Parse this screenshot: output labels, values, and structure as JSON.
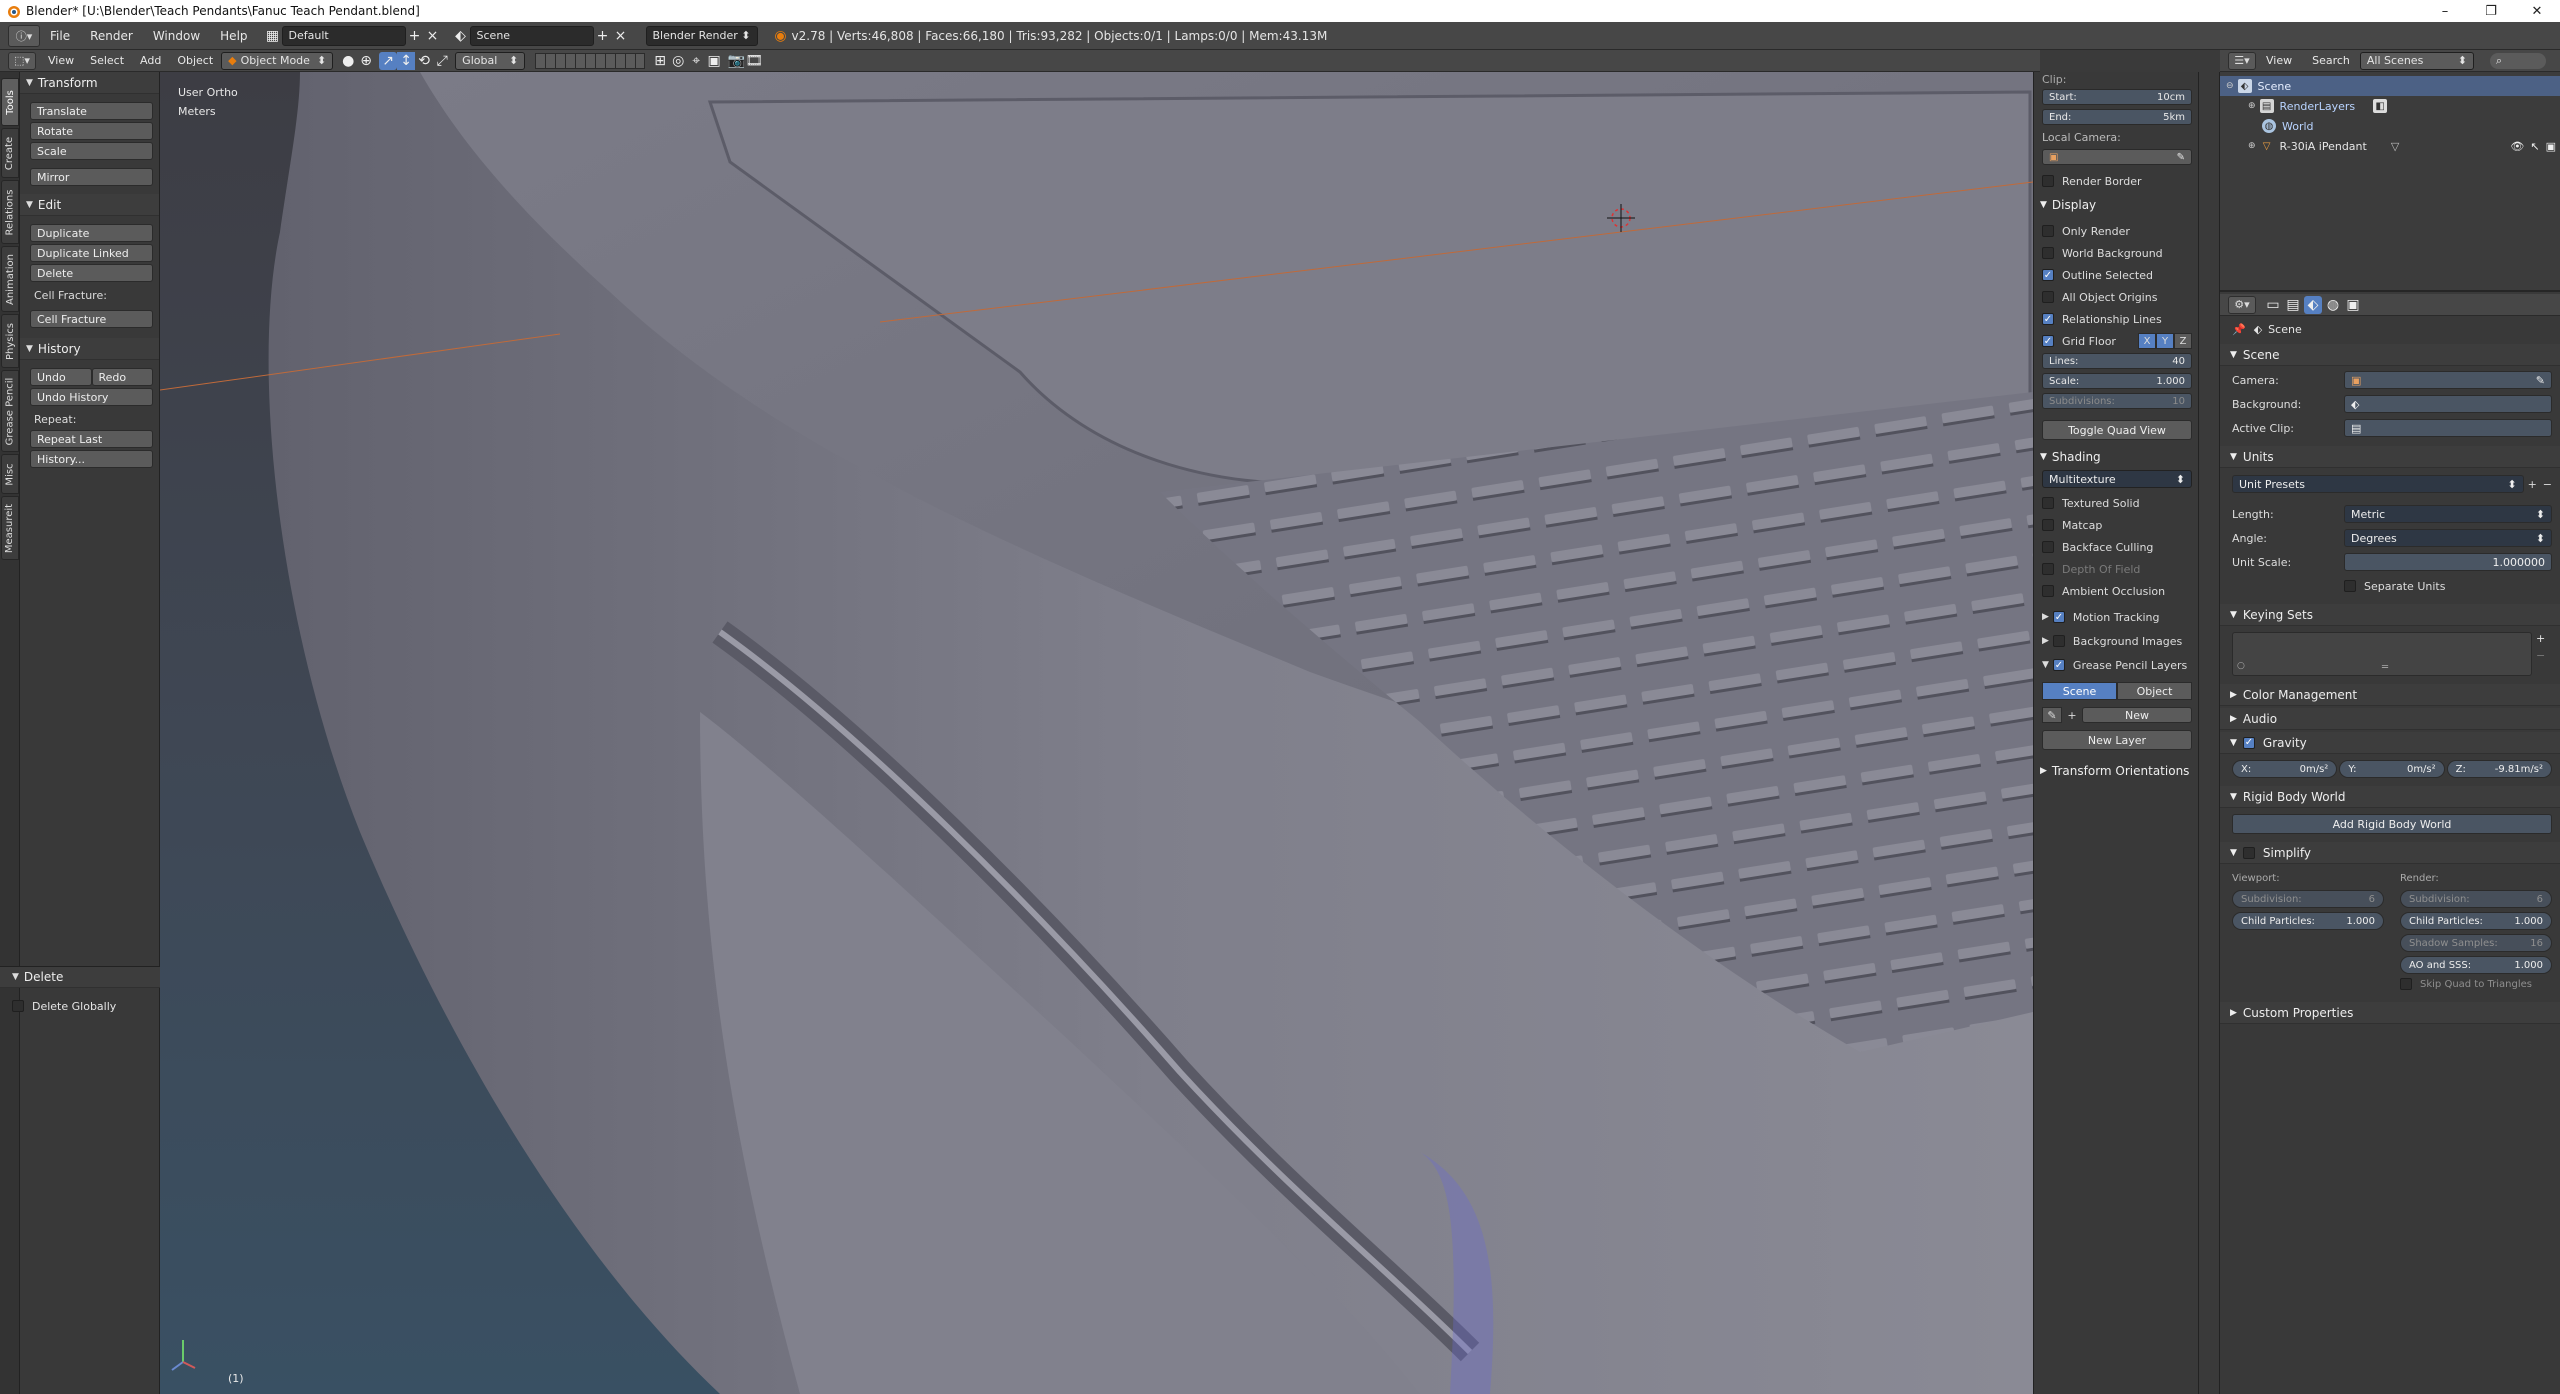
{
  "window": {
    "title": "Blender* [U:\\Blender\\Teach Pendants\\Fanuc Teach Pendant.blend]",
    "minimize_glyph": "–",
    "maximize_glyph": "❐",
    "close_glyph": "✕"
  },
  "info_header": {
    "editor_icon": "info-icon",
    "menus": [
      "File",
      "Render",
      "Window",
      "Help"
    ],
    "layout": "Default",
    "scene": "Scene",
    "engine": "Blender Render",
    "stats": "v2.78 | Verts:46,808 | Faces:66,180 | Tris:93,282 | Objects:0/1 | Lamps:0/0 | Mem:43.13M"
  },
  "view3d_header": {
    "menus": [
      "View",
      "Select",
      "Add",
      "Object"
    ],
    "mode": "Object Mode",
    "orientation": "Global"
  },
  "tabs": [
    "Tools",
    "Create",
    "Relations",
    "Animation",
    "Physics",
    "Grease Pencil",
    "Misc",
    "Measureit"
  ],
  "toolshelf": {
    "transform": {
      "title": "Transform",
      "buttons": [
        "Translate",
        "Rotate",
        "Scale",
        "Mirror"
      ]
    },
    "edit": {
      "title": "Edit",
      "buttons": [
        "Duplicate",
        "Duplicate Linked",
        "Delete"
      ],
      "label": "Cell Fracture:",
      "extra": "Cell Fracture"
    },
    "history": {
      "title": "History",
      "undo": "Undo",
      "redo": "Redo",
      "undo_history": "Undo History",
      "repeat_label": "Repeat:",
      "repeat_last": "Repeat Last",
      "history": "History..."
    },
    "operator": {
      "title": "Delete",
      "option": "Delete Globally"
    }
  },
  "viewport": {
    "view_name": "User Ortho",
    "units": "Meters",
    "frame": "(1)"
  },
  "npanel": {
    "clip_title": "Clip:",
    "clip_start_label": "Start:",
    "clip_start": "10cm",
    "clip_end_label": "End:",
    "clip_end": "5km",
    "local_camera": "Local Camera:",
    "render_border": "Render Border",
    "display": {
      "title": "Display",
      "items": [
        {
          "label": "Only Render",
          "checked": false
        },
        {
          "label": "World Background",
          "checked": false
        },
        {
          "label": "Outline Selected",
          "checked": true
        },
        {
          "label": "All Object Origins",
          "checked": false
        },
        {
          "label": "Relationship Lines",
          "checked": true
        }
      ],
      "grid_floor": "Grid Floor",
      "axes": [
        "X",
        "Y",
        "Z"
      ],
      "lines_label": "Lines:",
      "lines": "40",
      "scale_label": "Scale:",
      "scale": "1.000",
      "subdiv_label": "Subdivisions:",
      "subdiv": "10",
      "toggle_quad": "Toggle Quad View"
    },
    "shading": {
      "title": "Shading",
      "mode": "Multitexture",
      "items": [
        "Textured Solid",
        "Matcap",
        "Backface Culling",
        "Depth Of Field",
        "Ambient Occlusion"
      ]
    },
    "motion_tracking": "Motion Tracking",
    "background_images": "Background Images",
    "gp_layers": "Grease Pencil Layers",
    "gp_tabs": [
      "Scene",
      "Object"
    ],
    "gp_new": "New",
    "gp_new_layer": "New Layer",
    "transform_orient": "Transform Orientations"
  },
  "outliner": {
    "view": "View",
    "search": "Search",
    "filter": "All Scenes",
    "rows": [
      {
        "label": "Scene",
        "icon": "scene-icon"
      },
      {
        "label": "RenderLayers",
        "icon": "renderlayers-icon"
      },
      {
        "label": "World",
        "icon": "world-icon"
      },
      {
        "label": "R-30iA iPendant",
        "icon": "mesh-object-icon"
      }
    ]
  },
  "properties": {
    "context": "Scene",
    "scene_panel": {
      "title": "Scene",
      "camera": "Camera:",
      "background": "Background:",
      "active_clip": "Active Clip:"
    },
    "units_panel": {
      "title": "Units",
      "presets": "Unit Presets",
      "length_label": "Length:",
      "length": "Metric",
      "angle_label": "Angle:",
      "angle": "Degrees",
      "scale_label": "Unit Scale:",
      "scale": "1.000000",
      "separate": "Separate Units"
    },
    "keying_sets": "Keying Sets",
    "color_management": "Color Management",
    "audio": "Audio",
    "gravity": {
      "title": "Gravity",
      "x": "0m/s²",
      "y": "0m/s²",
      "z": "-9.81m/s²"
    },
    "rigid_body": {
      "title": "Rigid Body World",
      "button": "Add Rigid Body World"
    },
    "simplify": {
      "title": "Simplify",
      "viewport": "Viewport:",
      "render": "Render:",
      "subdivision_label": "Subdivision:",
      "vp_subdiv": "6",
      "r_subdiv": "6",
      "child_label": "Child Particles:",
      "vp_child": "1.000",
      "r_child": "1.000",
      "shadow_label": "Shadow Samples:",
      "shadow": "16",
      "ao_label": "AO and SSS:",
      "ao": "1.000",
      "skip_quad": "Skip Quad to Triangles"
    },
    "custom_props": "Custom Properties"
  }
}
